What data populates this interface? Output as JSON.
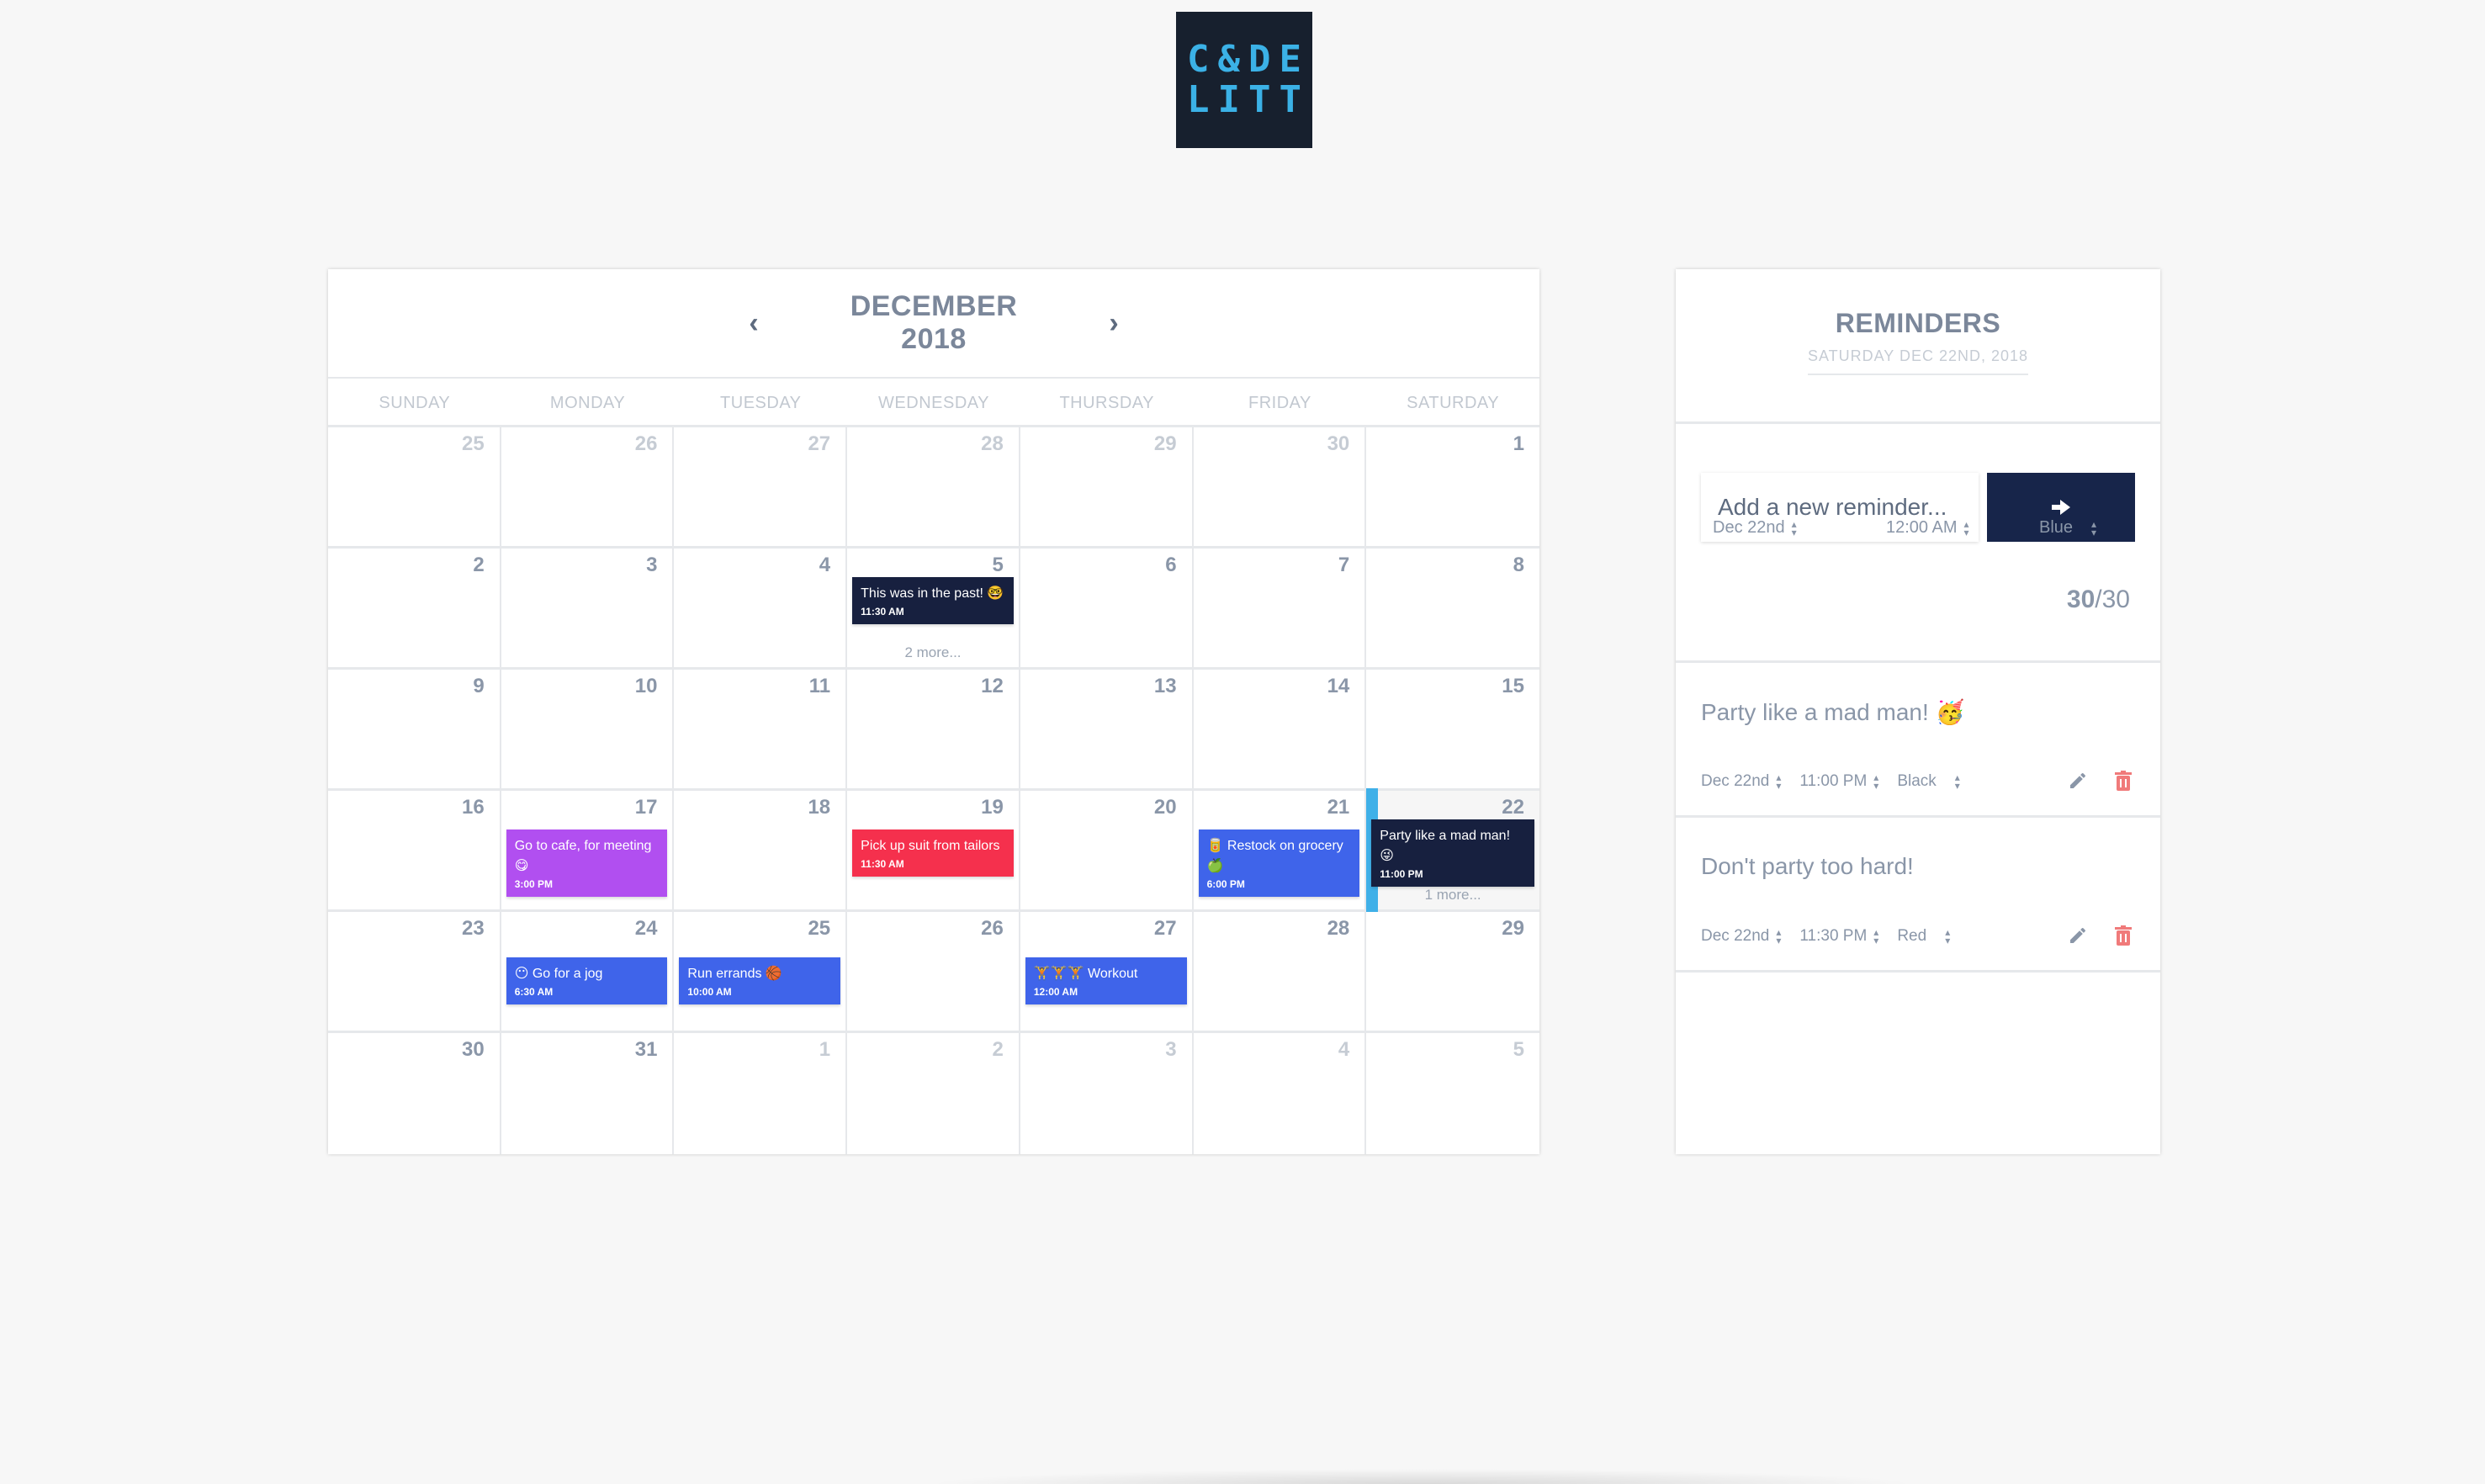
{
  "logo": {
    "line1": "C&DE",
    "line2": "LITT"
  },
  "calendar": {
    "month_title": "DECEMBER 2018",
    "prev_icon": "chevron-left-icon",
    "next_icon": "chevron-right-icon",
    "weekdays": [
      "SUNDAY",
      "MONDAY",
      "TUESDAY",
      "WEDNESDAY",
      "THURSDAY",
      "FRIDAY",
      "SATURDAY"
    ],
    "days": [
      {
        "num": "25",
        "muted": true
      },
      {
        "num": "26",
        "muted": true
      },
      {
        "num": "27",
        "muted": true
      },
      {
        "num": "28",
        "muted": true
      },
      {
        "num": "29",
        "muted": true
      },
      {
        "num": "30",
        "muted": true
      },
      {
        "num": "1"
      },
      {
        "num": "2"
      },
      {
        "num": "3"
      },
      {
        "num": "4"
      },
      {
        "num": "5",
        "event": {
          "text": "This was in the past! 🤓",
          "time": "11:30 AM",
          "color": "#17203f"
        },
        "more": "2 more..."
      },
      {
        "num": "6"
      },
      {
        "num": "7"
      },
      {
        "num": "8"
      },
      {
        "num": "9"
      },
      {
        "num": "10"
      },
      {
        "num": "11"
      },
      {
        "num": "12"
      },
      {
        "num": "13"
      },
      {
        "num": "14"
      },
      {
        "num": "15"
      },
      {
        "num": "16"
      },
      {
        "num": "17",
        "event": {
          "text": "Go to cafe, for meeting 😋",
          "time": "3:00 PM",
          "color": "#b14ff0"
        }
      },
      {
        "num": "18"
      },
      {
        "num": "19",
        "event": {
          "text": "Pick up suit from tailors",
          "time": "11:30 AM",
          "color": "#f5304d"
        }
      },
      {
        "num": "20"
      },
      {
        "num": "21",
        "event": {
          "text": "🥫 Restock on grocery 🍏",
          "time": "6:00 PM",
          "color": "#3f64ea"
        }
      },
      {
        "num": "22",
        "selected": true,
        "event": {
          "text": "Party like a mad man! 😜",
          "time": "11:00 PM",
          "color": "#17203f"
        },
        "more": "1 more..."
      },
      {
        "num": "23"
      },
      {
        "num": "24",
        "event": {
          "text": "😶 Go for a jog",
          "time": "6:30 AM",
          "color": "#3f64ea"
        }
      },
      {
        "num": "25",
        "event": {
          "text": "Run errands 🏀",
          "time": "10:00 AM",
          "color": "#3f64ea"
        }
      },
      {
        "num": "26"
      },
      {
        "num": "27",
        "event": {
          "text": "🏋🏋🏋 Workout",
          "time": "12:00 AM",
          "color": "#3f64ea"
        }
      },
      {
        "num": "28"
      },
      {
        "num": "29"
      },
      {
        "num": "30"
      },
      {
        "num": "31"
      },
      {
        "num": "1",
        "muted": true
      },
      {
        "num": "2",
        "muted": true
      },
      {
        "num": "3",
        "muted": true
      },
      {
        "num": "4",
        "muted": true
      },
      {
        "num": "5",
        "muted": true
      }
    ]
  },
  "reminders": {
    "title": "REMINDERS",
    "date": "SATURDAY DEC 22ND, 2018",
    "input_placeholder": "Add a new reminder...",
    "submit_icon": "arrow-right-icon",
    "form": {
      "date": "Dec 22nd",
      "time": "12:00 AM",
      "color": "Blue",
      "count": "30",
      "max": "/30"
    },
    "items": [
      {
        "text": "Party like a mad man! 🥳",
        "date": "Dec 22nd",
        "time": "11:00 PM",
        "color": "Black"
      },
      {
        "text": "Don't party too hard!",
        "date": "Dec 22nd",
        "time": "11:30 PM",
        "color": "Red"
      }
    ]
  }
}
